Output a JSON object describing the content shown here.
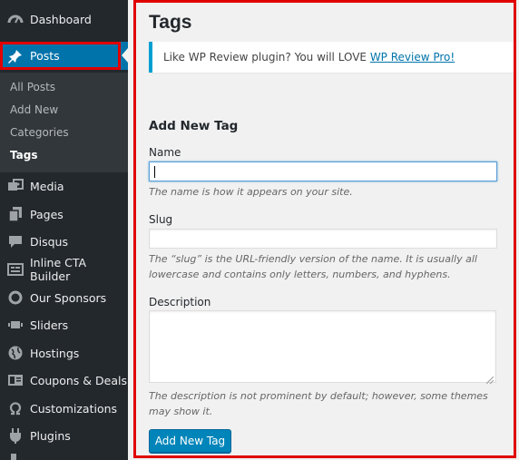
{
  "sidebar": {
    "items": [
      {
        "label": "Dashboard",
        "icon": "dashboard-icon"
      },
      {
        "label": "Posts",
        "icon": "pin-icon"
      },
      {
        "label": "Media",
        "icon": "media-icon"
      },
      {
        "label": "Pages",
        "icon": "pages-icon"
      },
      {
        "label": "Disqus",
        "icon": "comment-icon"
      },
      {
        "label": "Inline CTA Builder",
        "icon": "cta-icon"
      },
      {
        "label": "Our Sponsors",
        "icon": "circle-icon"
      },
      {
        "label": "Sliders",
        "icon": "slider-icon"
      },
      {
        "label": "Hostings",
        "icon": "globe-icon"
      },
      {
        "label": "Coupons & Deals",
        "icon": "coupon-icon"
      },
      {
        "label": "Customizations",
        "icon": "omega-icon"
      },
      {
        "label": "Plugins",
        "icon": "plugin-icon"
      }
    ],
    "submenu": [
      {
        "label": "All Posts"
      },
      {
        "label": "Add New"
      },
      {
        "label": "Categories"
      },
      {
        "label": "Tags"
      }
    ]
  },
  "main": {
    "title": "Tags",
    "notice": {
      "text": "Like WP Review plugin? You will LOVE ",
      "link": "WP Review Pro!"
    },
    "form": {
      "heading": "Add New Tag",
      "name_label": "Name",
      "name_value": "",
      "name_help": "The name is how it appears on your site.",
      "slug_label": "Slug",
      "slug_value": "",
      "slug_help": "The “slug” is the URL-friendly version of the name. It is usually all lowercase and contains only letters, numbers, and hyphens.",
      "description_label": "Description",
      "description_value": "",
      "description_help": "The description is not prominent by default; however, some themes may show it.",
      "submit_label": "Add New Tag"
    }
  },
  "colors": {
    "sidebar_bg": "#23282d",
    "submenu_bg": "#32373c",
    "accent": "#0073aa",
    "highlight_outline": "#e00000"
  }
}
